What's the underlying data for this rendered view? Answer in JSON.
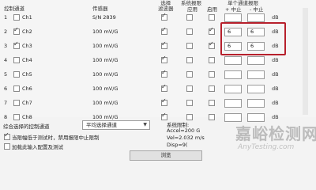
{
  "header": {
    "col_channel": "控制通道",
    "col_sensor": "传感器",
    "col_filter": "选择\n滤波器",
    "col_peak_group": "系统报限",
    "col_apply": "应用",
    "col_enable": "启用",
    "col_limit_group": "单个通道报限",
    "col_plus": "+ 中止",
    "col_minus": "- 中止"
  },
  "rows": [
    {
      "idx": "1",
      "checked": false,
      "name": "Ch1",
      "sensor": "S/N 2839",
      "filter": true,
      "apply": false,
      "enable": false,
      "limit_plus": "",
      "limit_minus": "",
      "unit": "dB"
    },
    {
      "idx": "2",
      "checked": true,
      "name": "Ch2",
      "sensor": "100 mV/G",
      "filter": true,
      "apply": false,
      "enable": true,
      "limit_plus": "6",
      "limit_minus": "6",
      "unit": "dB"
    },
    {
      "idx": "3",
      "checked": true,
      "name": "Ch3",
      "sensor": "100 mV/G",
      "filter": true,
      "apply": false,
      "enable": true,
      "limit_plus": "6",
      "limit_minus": "6",
      "unit": "dB"
    },
    {
      "idx": "4",
      "checked": false,
      "name": "Ch4",
      "sensor": "100 mV/G",
      "filter": true,
      "apply": false,
      "enable": false,
      "limit_plus": "",
      "limit_minus": "",
      "unit": "dB"
    },
    {
      "idx": "5",
      "checked": false,
      "name": "Ch5",
      "sensor": "100 mV/G",
      "filter": true,
      "apply": false,
      "enable": false,
      "limit_plus": "",
      "limit_minus": "",
      "unit": "dB"
    },
    {
      "idx": "6",
      "checked": false,
      "name": "Ch6",
      "sensor": "100 mV/G",
      "filter": true,
      "apply": false,
      "enable": false,
      "limit_plus": "",
      "limit_minus": "",
      "unit": "dB"
    },
    {
      "idx": "7",
      "checked": false,
      "name": "Ch7",
      "sensor": "100 mV/G",
      "filter": true,
      "apply": false,
      "enable": false,
      "limit_plus": "",
      "limit_minus": "",
      "unit": "dB"
    },
    {
      "idx": "8",
      "checked": false,
      "name": "Ch8",
      "sensor": "100 mV/G",
      "filter": true,
      "apply": false,
      "enable": false,
      "limit_plus": "",
      "limit_minus": "",
      "unit": "dB"
    }
  ],
  "bottom": {
    "combine_label": "综合选择的控制通道",
    "combine_value": "平均选择通道",
    "option1_label": "当限幅低于测试时，禁用报限中止限制",
    "option1_checked": true,
    "option2_label": "加载此输入配置及测试",
    "option2_checked": false,
    "system_limits_label": "系统限制:",
    "accel": "Accel=200 G",
    "vel": "Vel=2.032 m/s",
    "disp": "Disp=9(",
    "browse_label": "浏览"
  },
  "watermark": {
    "main": "嘉峪检测网",
    "sub": "AnyTesting.com"
  },
  "colors": {
    "highlight_border": "#b7202c"
  }
}
